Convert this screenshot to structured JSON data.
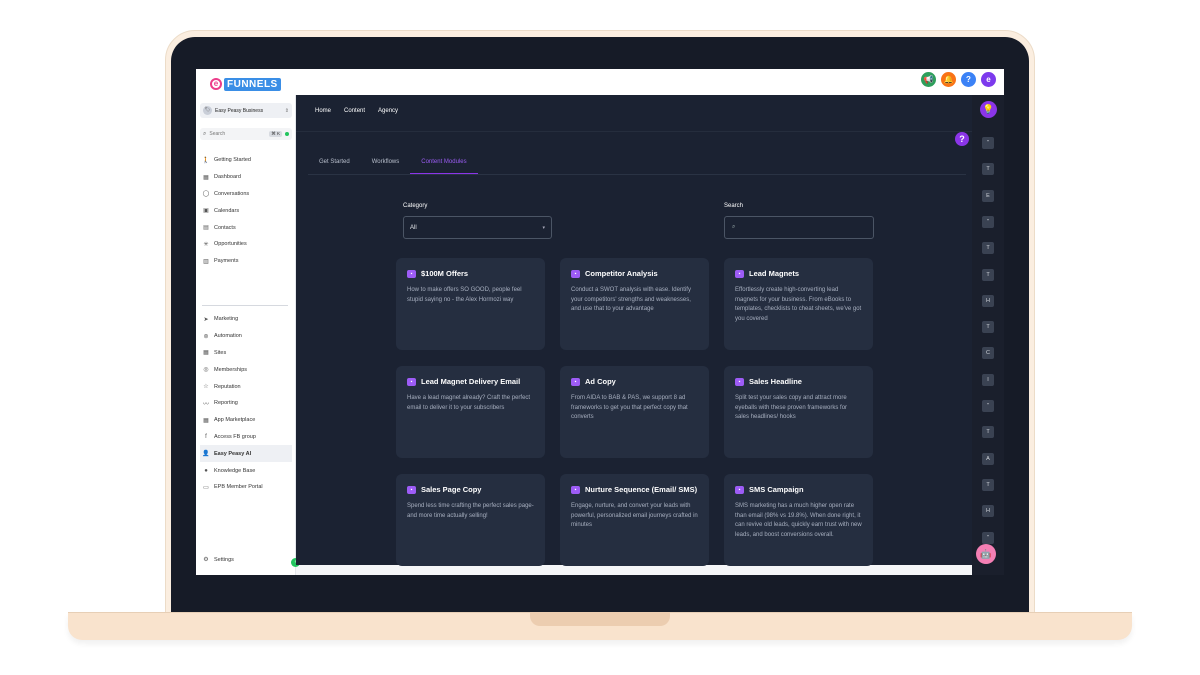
{
  "brand": {
    "logo_text": "FUNNELS",
    "logo_letter": "e"
  },
  "top_icons": [
    {
      "name": "megaphone-icon",
      "glyph": "📢",
      "color": "#2e9e5b"
    },
    {
      "name": "bell-icon",
      "glyph": "🔔",
      "color": "#f97316"
    },
    {
      "name": "help-icon",
      "glyph": "?",
      "color": "#3b82f6"
    },
    {
      "name": "profile-icon",
      "glyph": "e",
      "color": "#7c3aed"
    }
  ],
  "sidebar": {
    "account": {
      "avatar": "🏷",
      "name": "Easy Peasy Business"
    },
    "search": {
      "placeholder": "Search",
      "shortcut": "⌘ K"
    },
    "primary_items": [
      {
        "label": "Getting Started",
        "icon": "walk-icon",
        "glyph": "🚶"
      },
      {
        "label": "Dashboard",
        "icon": "dashboard-icon",
        "glyph": "▦"
      },
      {
        "label": "Conversations",
        "icon": "chat-icon",
        "glyph": "◯"
      },
      {
        "label": "Calendars",
        "icon": "calendar-icon",
        "glyph": "▣"
      },
      {
        "label": "Contacts",
        "icon": "contacts-icon",
        "glyph": "▤"
      },
      {
        "label": "Opportunities",
        "icon": "opportunities-icon",
        "glyph": "✳"
      },
      {
        "label": "Payments",
        "icon": "payments-icon",
        "glyph": "▥"
      }
    ],
    "secondary_items": [
      {
        "label": "Marketing",
        "icon": "send-icon",
        "glyph": "➤"
      },
      {
        "label": "Automation",
        "icon": "automation-icon",
        "glyph": "⊚"
      },
      {
        "label": "Sites",
        "icon": "sites-icon",
        "glyph": "▦"
      },
      {
        "label": "Memberships",
        "icon": "memberships-icon",
        "glyph": "◎"
      },
      {
        "label": "Reputation",
        "icon": "star-icon",
        "glyph": "☆"
      },
      {
        "label": "Reporting",
        "icon": "reporting-icon",
        "glyph": "〰"
      },
      {
        "label": "App Marketplace",
        "icon": "marketplace-icon",
        "glyph": "▦"
      },
      {
        "label": "Access FB group",
        "icon": "facebook-icon",
        "glyph": "f"
      },
      {
        "label": "Easy Peasy AI",
        "icon": "ai-icon",
        "glyph": "👤",
        "active": true
      },
      {
        "label": "Knowledge Base",
        "icon": "globe-icon",
        "glyph": "●"
      },
      {
        "label": "EPB Member Portal",
        "icon": "portal-icon",
        "glyph": "▭"
      }
    ],
    "settings_label": "Settings",
    "collapse_glyph": "‹"
  },
  "main": {
    "top_nav": [
      "Home",
      "Content",
      "Agency"
    ],
    "tabs": [
      {
        "label": "Get Started",
        "active": false
      },
      {
        "label": "Workflows",
        "active": false
      },
      {
        "label": "Content Modules",
        "active": true
      }
    ],
    "category": {
      "label": "Category",
      "value": "All"
    },
    "search": {
      "label": "Search",
      "placeholder": ""
    },
    "cards": [
      {
        "title": "$100M Offers",
        "desc": "How to make offers SO GOOD, people feel stupid saying no - the Alex Hormozi way"
      },
      {
        "title": "Competitor Analysis",
        "desc": "Conduct a SWOT analysis with ease. Identify your competitors' strengths and weaknesses, and use that to your advantage"
      },
      {
        "title": "Lead Magnets",
        "desc": "Effortlessly create high-converting lead magnets for your business. From eBooks to templates, checklists to cheat sheets, we've got you covered"
      },
      {
        "title": "Lead Magnet Delivery Email",
        "desc": "Have a lead magnet already? Craft the perfect email to deliver it to your subscribers"
      },
      {
        "title": "Ad Copy",
        "desc": "From AIDA to BAB & PAS, we support 8 ad frameworks to get you that perfect copy that converts"
      },
      {
        "title": "Sales Headline",
        "desc": "Split test your sales copy and attract more eyeballs with these proven frameworks for sales headlines/ hooks"
      },
      {
        "title": "Sales Page Copy",
        "desc": "Spend less time crafting the perfect sales page- and more time actually selling!"
      },
      {
        "title": "Nurture Sequence (Email/ SMS)",
        "desc": "Engage, nurture, and convert your leads with powerful, personalized email journeys crafted in minutes"
      },
      {
        "title": "SMS Campaign",
        "desc": "SMS marketing has a much higher open rate than email (98% vs 19.8%). When done right, it can revive old leads, quickly earn trust with new leads, and boost conversions overall."
      }
    ]
  },
  "rail": {
    "buttons": [
      "\"",
      "T",
      "E",
      "\"",
      "T",
      "T",
      "H",
      "T",
      "C",
      "I",
      "\"",
      "T",
      "A",
      "T",
      "H",
      "\""
    ]
  },
  "colors": {
    "accent": "#8b35e8",
    "panel": "#1b2232",
    "card": "#252e40"
  }
}
